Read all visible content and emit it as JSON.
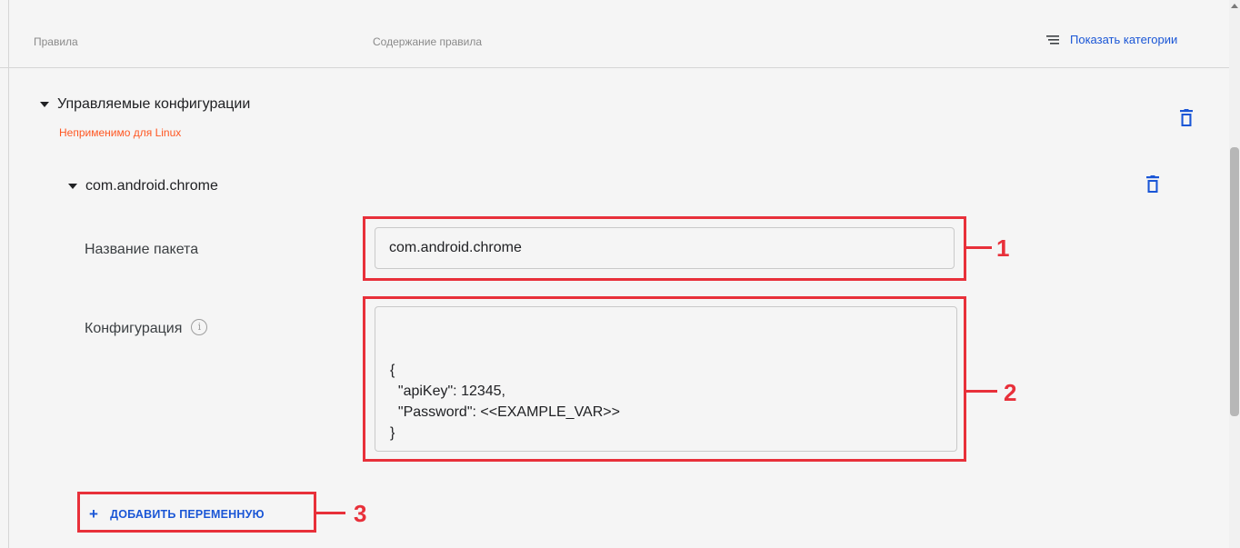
{
  "header": {
    "col_rules": "Правила",
    "col_content": "Содержание правила",
    "show_categories": "Показать категории"
  },
  "section": {
    "title": "Управляемые конфигурации",
    "warning": "Неприменимо для Linux"
  },
  "package": {
    "title": "com.android.chrome",
    "name_label": "Название пакета",
    "name_value": "com.android.chrome",
    "config_label": "Конфигурация",
    "config_lines": [
      "{",
      "  \"apiKey\": 12345,",
      "  \"Password\": <<EXAMPLE_VAR>>",
      "}"
    ]
  },
  "add_variable": "ДОБАВИТЬ ПЕРЕМЕННУЮ",
  "callouts": [
    "1",
    "2",
    "3"
  ],
  "colors": {
    "accent": "#1a56d6",
    "warning": "#ff5722",
    "callout": "#e8303a"
  },
  "icons": [
    "list-icon",
    "trash-icon",
    "caret-down-icon",
    "info-icon",
    "plus-icon"
  ]
}
